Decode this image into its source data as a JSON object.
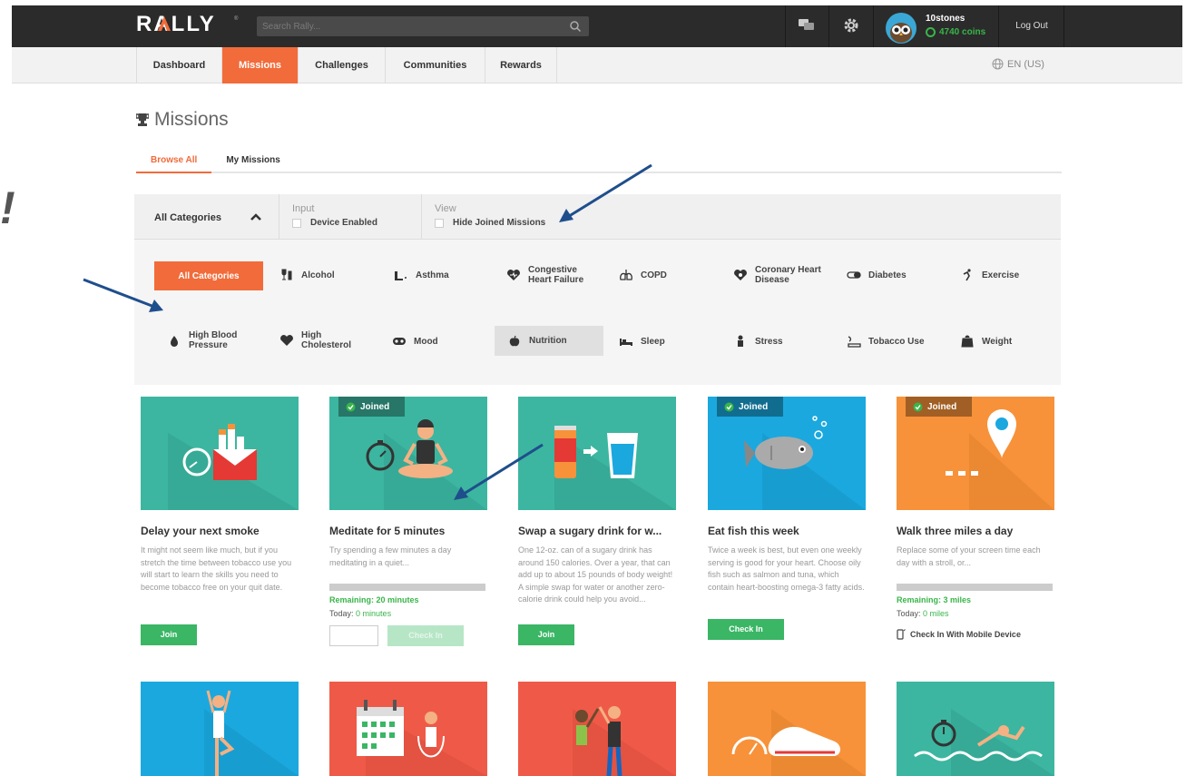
{
  "app": {
    "logo_text": "RALLY",
    "logo_reg": "®"
  },
  "header": {
    "search_placeholder": "Search Rally...",
    "user": {
      "name": "10stones",
      "coins": "4740 coins"
    },
    "logout_label": "Log Out"
  },
  "nav": {
    "items": [
      {
        "label": "Dashboard",
        "active": false
      },
      {
        "label": "Missions",
        "active": true
      },
      {
        "label": "Challenges",
        "active": false
      },
      {
        "label": "Communities",
        "active": false
      },
      {
        "label": "Rewards",
        "active": false
      }
    ],
    "language": "EN (US)"
  },
  "page": {
    "title": "Missions"
  },
  "tabs": [
    {
      "label": "Browse All",
      "active": true
    },
    {
      "label": "My Missions",
      "active": false
    }
  ],
  "filters": {
    "category_select": "All Categories",
    "input": {
      "label": "Input",
      "option": "Device Enabled",
      "checked": false
    },
    "view": {
      "label": "View",
      "option": "Hide Joined Missions",
      "checked": false
    }
  },
  "categories": [
    {
      "label": "All Categories",
      "icon": "none",
      "active": true
    },
    {
      "label": "Alcohol",
      "icon": "wine-icon"
    },
    {
      "label": "Asthma",
      "icon": "lungs-icon"
    },
    {
      "label": "Congestive Heart Failure",
      "icon": "heart-icon"
    },
    {
      "label": "COPD",
      "icon": "lungs-icon"
    },
    {
      "label": "Coronary Heart Disease",
      "icon": "heart-icon"
    },
    {
      "label": "Diabetes",
      "icon": "pill-icon"
    },
    {
      "label": "Exercise",
      "icon": "runner-icon"
    },
    {
      "label": "High Blood Pressure",
      "icon": "drop-icon"
    },
    {
      "label": "High Cholesterol",
      "icon": "heart-icon"
    },
    {
      "label": "Mood",
      "icon": "mask-icon"
    },
    {
      "label": "Nutrition",
      "icon": "apple-icon",
      "hover": true
    },
    {
      "label": "Sleep",
      "icon": "bed-icon"
    },
    {
      "label": "Stress",
      "icon": "person-icon"
    },
    {
      "label": "Tobacco Use",
      "icon": "cigarette-icon"
    },
    {
      "label": "Weight",
      "icon": "weight-icon"
    }
  ],
  "missions": [
    {
      "title": "Delay your next smoke",
      "description": "It might not seem like much, but if you stretch the time between tobacco use you will start to learn the skills you need to become tobacco free on your quit date.",
      "joined": false,
      "button": "Join",
      "image_bg": "#3cb6a0"
    },
    {
      "title": "Meditate for 5 minutes",
      "description": "Try spending a few minutes a day meditating in a quiet...",
      "joined": true,
      "joined_label": "Joined",
      "remaining": "Remaining: 20 minutes",
      "today_label": "Today:",
      "today_value": "0 minutes",
      "progress": 0,
      "button": "Check In",
      "button_disabled": true,
      "image_bg": "#3cb6a0"
    },
    {
      "title": "Swap a sugary drink for w...",
      "description": "One 12-oz. can of a sugary drink has around 150 calories. Over a year, that can add up to about 15 pounds of body weight! A simple swap for water or another zero-calorie drink could help you avoid...",
      "joined": false,
      "button": "Join",
      "image_bg": "#3cb6a0"
    },
    {
      "title": "Eat fish this week",
      "description": "Twice a week is best, but even one weekly serving is good for your heart. Choose oily fish such as salmon and tuna, which contain heart-boosting omega-3 fatty acids.",
      "joined": true,
      "joined_label": "Joined",
      "button": "Check In",
      "image_bg": "#1ba8de"
    },
    {
      "title": "Walk three miles a day",
      "description": "Replace some of your screen time each day with a stroll, or...",
      "joined": true,
      "joined_label": "Joined",
      "remaining": "Remaining: 3 miles",
      "today_label": "Today:",
      "today_value": "0 miles",
      "progress": 0,
      "mobile_label": "Check In With Mobile Device",
      "image_bg": "#f7923a"
    }
  ],
  "row2_image_bgs": [
    "#1ba8de",
    "#ef5a48",
    "#ef5a48",
    "#f7923a",
    "#3cb6a0"
  ],
  "colors": {
    "accent": "#f26b3a",
    "green": "#3ab665",
    "topbar": "#2b2b2b",
    "arrow": "#1f4e8c"
  }
}
